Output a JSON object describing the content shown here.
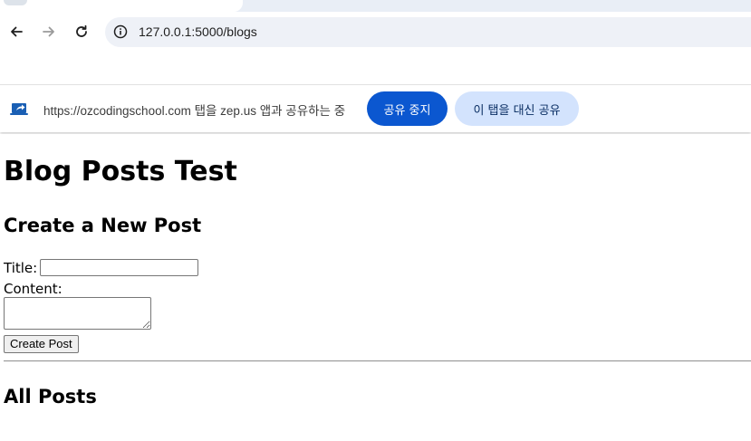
{
  "browser": {
    "url": "127.0.0.1:5000/blogs",
    "icons": {
      "back": "arrow-left-icon",
      "forward": "arrow-right-icon",
      "reload": "reload-icon",
      "site_info": "info-icon"
    }
  },
  "share_bar": {
    "message": "https://ozcodingschool.com 탭을 zep.us 앱과 공유하는 중",
    "stop_label": "공유 중지",
    "share_instead_label": "이 탭을 대신 공유",
    "colors": {
      "stop_bg": "#0b57d0",
      "share_instead_bg": "#d3e3fd",
      "icon": "#1a5fb4"
    }
  },
  "page": {
    "heading": "Blog Posts Test",
    "create_heading": "Create a New Post",
    "title_label": "Title:",
    "title_value": "",
    "content_label": "Content:",
    "content_value": "",
    "create_button": "Create Post",
    "all_posts_heading": "All Posts"
  }
}
